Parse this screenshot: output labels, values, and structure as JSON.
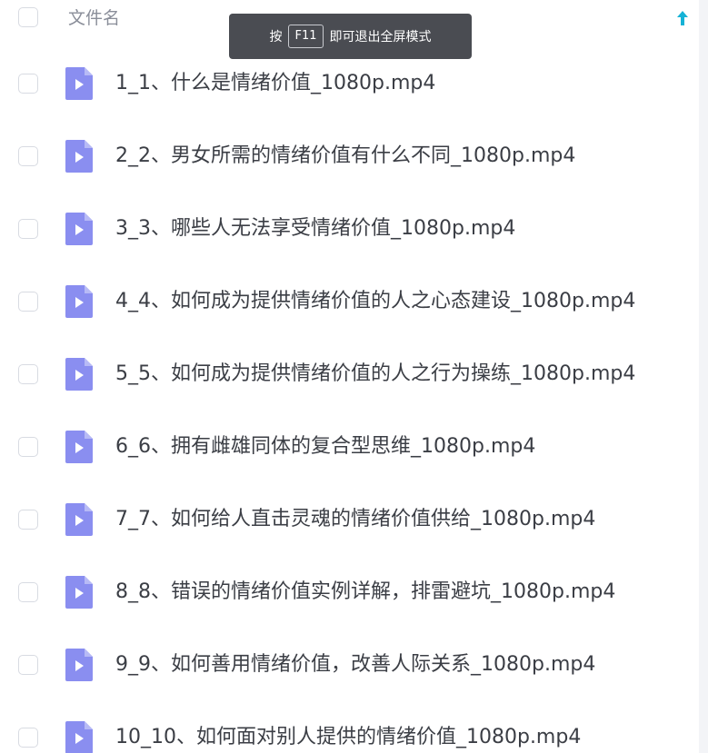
{
  "header": {
    "column_label": "文件名",
    "sort_icon": "arrow-up-icon"
  },
  "toast": {
    "prefix": "按",
    "key": "F11",
    "suffix": "即可退出全屏模式"
  },
  "colors": {
    "file_icon": "#8a8ef0",
    "sort_arrow": "#16b2d6",
    "toast_bg": "#4a4c52"
  },
  "files": [
    {
      "name": "1_1、什么是情绪价值_1080p.mp4",
      "icon": "video-file-icon"
    },
    {
      "name": "2_2、男女所需的情绪价值有什么不同_1080p.mp4",
      "icon": "video-file-icon"
    },
    {
      "name": "3_3、哪些人无法享受情绪价值_1080p.mp4",
      "icon": "video-file-icon"
    },
    {
      "name": "4_4、如何成为提供情绪价值的人之心态建设_1080p.mp4",
      "icon": "video-file-icon"
    },
    {
      "name": "5_5、如何成为提供情绪价值的人之行为操练_1080p.mp4",
      "icon": "video-file-icon"
    },
    {
      "name": "6_6、拥有雌雄同体的复合型思维_1080p.mp4",
      "icon": "video-file-icon"
    },
    {
      "name": "7_7、如何给人直击灵魂的情绪价值供给_1080p.mp4",
      "icon": "video-file-icon"
    },
    {
      "name": "8_8、错误的情绪价值实例详解，排雷避坑_1080p.mp4",
      "icon": "video-file-icon"
    },
    {
      "name": "9_9、如何善用情绪价值，改善人际关系_1080p.mp4",
      "icon": "video-file-icon"
    },
    {
      "name": "10_10、如何面对别人提供的情绪价值_1080p.mp4",
      "icon": "video-file-icon"
    }
  ]
}
